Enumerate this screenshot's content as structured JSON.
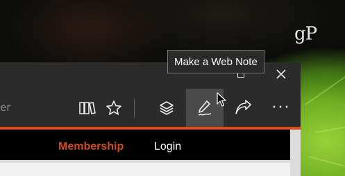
{
  "watermark": {
    "logo_text": "gP"
  },
  "browser": {
    "address_bar": {
      "partial_text": "er"
    },
    "toolbar": {
      "buttons": [
        {
          "name": "reading-view-icon"
        },
        {
          "name": "favorites-star-icon"
        },
        {
          "name": "hub-icon"
        },
        {
          "name": "web-note-pen-icon",
          "active": true
        },
        {
          "name": "share-icon"
        },
        {
          "name": "more-icon",
          "label": "···"
        }
      ]
    },
    "tooltip": {
      "text": "Make a Web Note"
    },
    "page": {
      "nav": {
        "membership": "Membership",
        "login": "Login"
      }
    }
  },
  "colors": {
    "accent_orange": "#e0491b",
    "membership_text": "#d24a1c",
    "toolbar_bg": "#2b2b2b",
    "active_button_bg": "#4a4a4a"
  }
}
